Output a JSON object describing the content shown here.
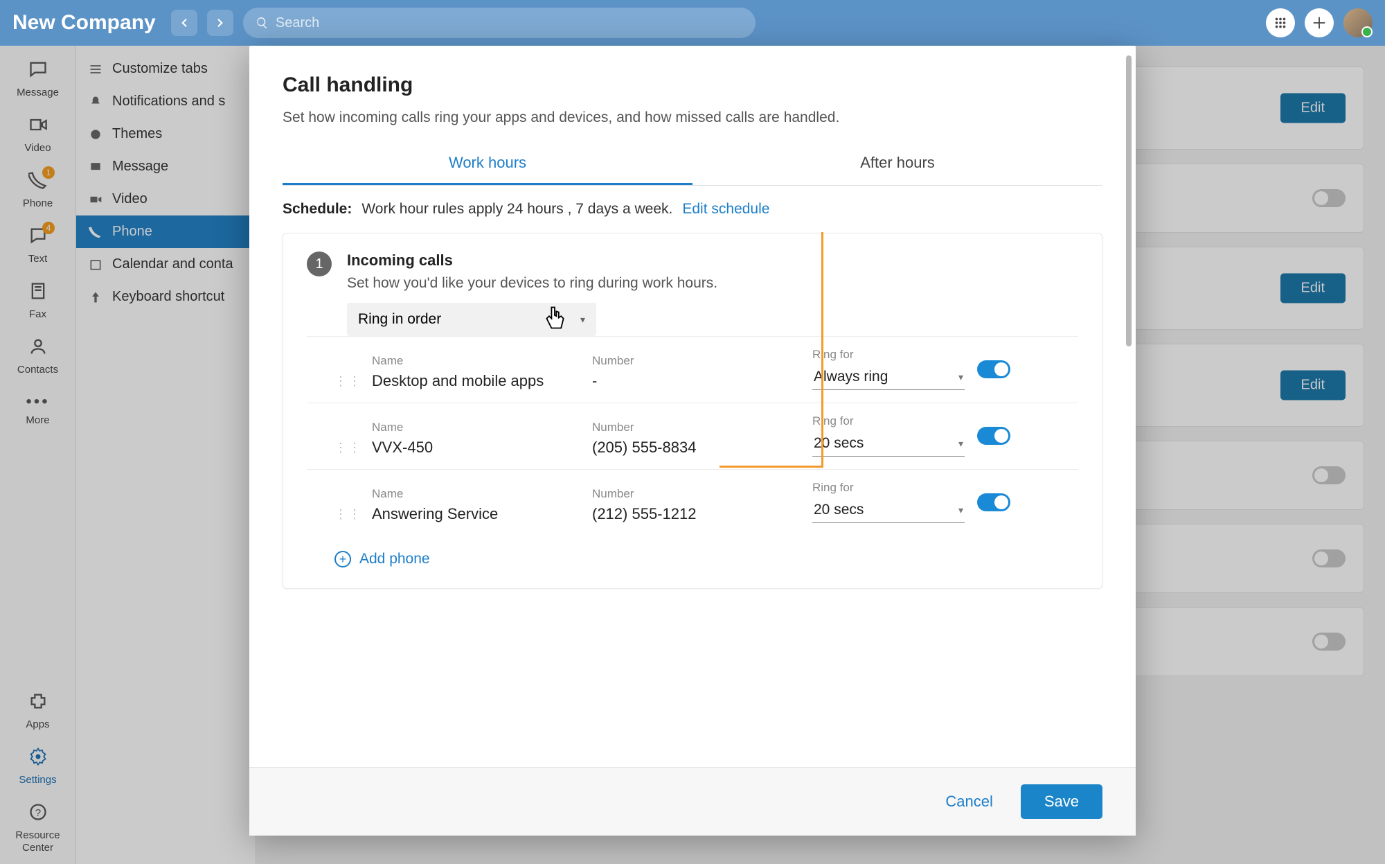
{
  "topbar": {
    "company": "New Company",
    "search_placeholder": "Search"
  },
  "rail": {
    "message": "Message",
    "video": "Video",
    "phone": "Phone",
    "phone_badge": "1",
    "text": "Text",
    "text_badge": "4",
    "fax": "Fax",
    "contacts": "Contacts",
    "more": "More",
    "apps": "Apps",
    "settings": "Settings",
    "resource": "Resource Center"
  },
  "settings_list": {
    "customize": "Customize tabs",
    "notifications": "Notifications and s",
    "themes": "Themes",
    "message": "Message",
    "video": "Video",
    "phone": "Phone",
    "calendar": "Calendar and conta",
    "keyboard": "Keyboard shortcut"
  },
  "bg": {
    "edit": "Edit"
  },
  "dialog": {
    "title": "Call handling",
    "desc": "Set how incoming calls ring your apps and devices, and how missed calls are handled.",
    "tabs": {
      "work": "Work hours",
      "after": "After hours"
    },
    "schedule_label": "Schedule:",
    "schedule_val": "Work hour rules apply 24 hours , 7 days a week.",
    "schedule_link": "Edit schedule",
    "step": "1",
    "section_title": "Incoming calls",
    "section_sub": "Set how you'd like your devices to ring during work hours.",
    "ring_mode": "Ring in order",
    "cols": {
      "name": "Name",
      "number": "Number",
      "ringfor": "Ring for"
    },
    "devices": [
      {
        "name": "Desktop and mobile apps",
        "number": "-",
        "ringfor": "Always ring",
        "on": true
      },
      {
        "name": "VVX-450",
        "number": "(205) 555-8834",
        "ringfor": "20 secs",
        "on": true
      },
      {
        "name": "Answering Service",
        "number": "(212) 555-1212",
        "ringfor": "20 secs",
        "on": true
      }
    ],
    "add_phone": "Add phone",
    "cancel": "Cancel",
    "save": "Save"
  }
}
